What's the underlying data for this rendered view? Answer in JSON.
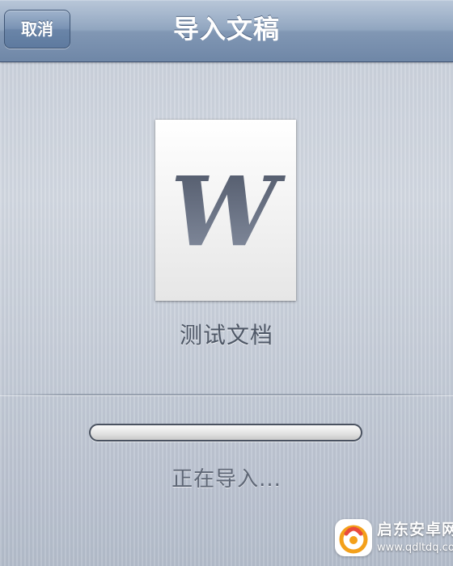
{
  "navbar": {
    "cancel_label": "取消",
    "title": "导入文稿"
  },
  "document": {
    "icon": "word-document-icon",
    "icon_letter": "W",
    "name": "测试文档"
  },
  "progress": {
    "value": 0,
    "status_text": "正在导入..."
  },
  "watermark": {
    "icon": "qidong-logo-icon",
    "name": "启东安卓网",
    "url": "www.qdltdq.com"
  },
  "colors": {
    "navbar": "#8197b4",
    "background": "#c9d0db",
    "text_dark": "#4e5766",
    "watermark_accent": "#f3a01a"
  }
}
